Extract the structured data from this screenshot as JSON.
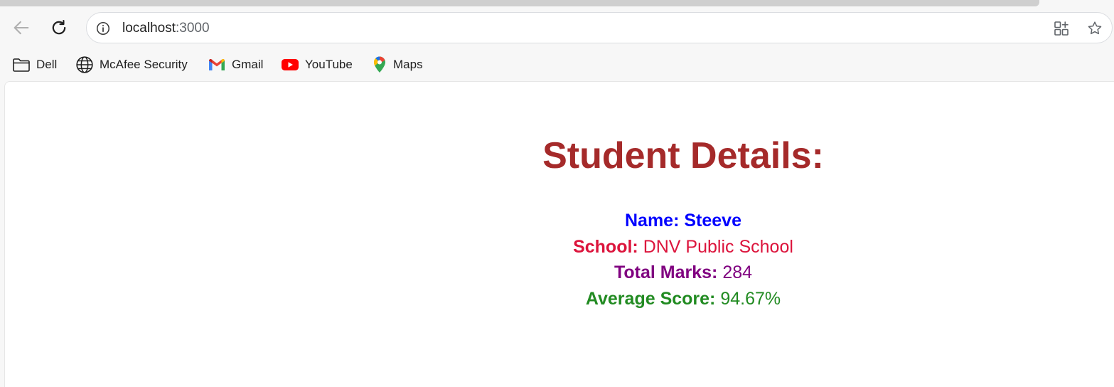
{
  "browser": {
    "url_host": "localhost",
    "url_port": ":3000",
    "bookmarks": [
      {
        "label": "Dell",
        "icon": "folder-icon"
      },
      {
        "label": "McAfee Security",
        "icon": "globe-icon"
      },
      {
        "label": "Gmail",
        "icon": "gmail-icon"
      },
      {
        "label": "YouTube",
        "icon": "youtube-icon"
      },
      {
        "label": "Maps",
        "icon": "maps-icon"
      }
    ]
  },
  "page": {
    "title": "Student Details:",
    "name_label": "Name:",
    "name_value": "Steeve",
    "school_label": "School:",
    "school_value": "DNV Public School",
    "marks_label": "Total Marks:",
    "marks_value": "284",
    "average_label": "Average Score:",
    "average_value": "94.67%"
  },
  "colors": {
    "title": "#a52a2a",
    "name": "#0000ff",
    "school": "#dc143c",
    "marks": "#800080",
    "average": "#228b22"
  }
}
